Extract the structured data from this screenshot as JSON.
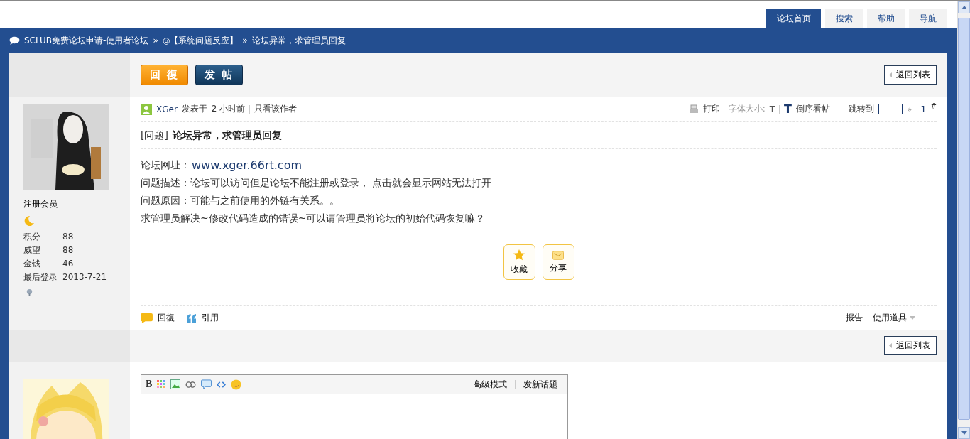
{
  "nav_tabs": [
    {
      "label": "论坛首页",
      "selected": true
    },
    {
      "label": "搜索",
      "selected": false
    },
    {
      "label": "帮助",
      "selected": false
    },
    {
      "label": "导航",
      "selected": false
    }
  ],
  "breadcrumb": [
    "SCLUB免费论坛申请-使用者论坛",
    "»",
    "◎【系统问题反应】",
    "»",
    "论坛异常，求管理员回复"
  ],
  "toolbar": {
    "reply_button": "回 復",
    "post_button": "发 帖",
    "back_button": "返回列表"
  },
  "post": {
    "author": {
      "rank": "注册会员",
      "stats": [
        {
          "label": "积分",
          "value": "88"
        },
        {
          "label": "威望",
          "value": "88"
        },
        {
          "label": "金钱",
          "value": "46"
        },
        {
          "label": "最后登录",
          "value": "2013-7-21"
        }
      ]
    },
    "author_name": "XGer",
    "posted_label": "发表于",
    "posted_time": "2 小时前",
    "only_author": "只看该作者",
    "tools": {
      "print": "打印",
      "font_size_label": "字体大小:",
      "font_small": "T",
      "font_large": "T",
      "reverse": "倒序看帖",
      "jump_label": "跳转到",
      "jump_arrow": "»",
      "floor": "1",
      "floor_mark": "#"
    },
    "title_tag": "[问题]",
    "title": "论坛异常，求管理员回复",
    "body": [
      {
        "kind": "link",
        "label": "论坛网址：",
        "text": "www.xger.66rt.com"
      },
      {
        "kind": "text",
        "text": "问题描述：论坛可以访问但是论坛不能注册或登录， 点击就会显示网站无法打开"
      },
      {
        "kind": "text",
        "text": "问题原因：可能与之前使用的外链有关系。。"
      },
      {
        "kind": "text",
        "text": "求管理员解决~修改代码造成的错误~可以请管理员将论坛的初始代码恢复嘛？"
      }
    ],
    "actions": [
      {
        "kind": "favorite",
        "label": "收藏"
      },
      {
        "kind": "share",
        "label": "分享"
      }
    ],
    "footer_left": [
      {
        "kind": "reply",
        "label": "回復"
      },
      {
        "kind": "quote",
        "label": "引用"
      }
    ],
    "footer_right": [
      "报告",
      "使用道具"
    ]
  },
  "bottom_toolbar": {
    "back_button": "返回列表"
  },
  "editor": {
    "bold_button": "B",
    "links": [
      "高级模式",
      "发新话题"
    ]
  }
}
